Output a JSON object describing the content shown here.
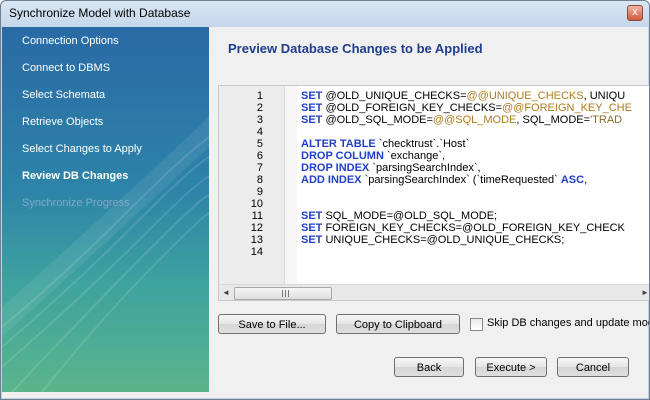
{
  "window": {
    "title": "Synchronize Model with Database",
    "close_glyph": "x"
  },
  "sidebar": {
    "steps": [
      {
        "label": "Connection Options",
        "state": "done"
      },
      {
        "label": "Connect to DBMS",
        "state": "done"
      },
      {
        "label": "Select Schemata",
        "state": "done"
      },
      {
        "label": "Retrieve Objects",
        "state": "done"
      },
      {
        "label": "Select Changes to Apply",
        "state": "done"
      },
      {
        "label": "Review DB Changes",
        "state": "active"
      },
      {
        "label": "Synchronize Progress",
        "state": "disabled"
      }
    ]
  },
  "main": {
    "title": "Preview Database Changes to be Applied",
    "editor": {
      "line_numbers": [
        "1",
        "2",
        "3",
        "4",
        "5",
        "6",
        "7",
        "8",
        "9",
        "10",
        "11",
        "12",
        "13",
        "14"
      ],
      "lines": [
        [
          {
            "t": "kw",
            "v": "SET"
          },
          {
            "t": "p",
            "v": " @OLD_UNIQUE_CHECKS="
          },
          {
            "t": "sv",
            "v": "@@UNIQUE_CHECKS"
          },
          {
            "t": "p",
            "v": ", UNIQU"
          }
        ],
        [
          {
            "t": "kw",
            "v": "SET"
          },
          {
            "t": "p",
            "v": " @OLD_FOREIGN_KEY_CHECKS="
          },
          {
            "t": "sv",
            "v": "@@FOREIGN_KEY_CHE"
          }
        ],
        [
          {
            "t": "kw",
            "v": "SET"
          },
          {
            "t": "p",
            "v": " @OLD_SQL_MODE="
          },
          {
            "t": "sv",
            "v": "@@SQL_MODE"
          },
          {
            "t": "p",
            "v": ", SQL_MODE="
          },
          {
            "t": "str",
            "v": "'TRAD"
          }
        ],
        [],
        [
          {
            "t": "kw",
            "v": "ALTER TABLE"
          },
          {
            "t": "p",
            "v": " `checktrust`.`Host`"
          }
        ],
        [
          {
            "t": "kw",
            "v": "DROP COLUMN"
          },
          {
            "t": "p",
            "v": " `exchange`,"
          }
        ],
        [
          {
            "t": "kw",
            "v": "DROP INDEX"
          },
          {
            "t": "p",
            "v": " `parsingSearchIndex`,"
          }
        ],
        [
          {
            "t": "kw",
            "v": "ADD INDEX"
          },
          {
            "t": "p",
            "v": " `parsingSearchIndex` ("
          },
          {
            "t": "p",
            "v": "`timeRequested` "
          },
          {
            "t": "kw",
            "v": "ASC"
          },
          {
            "t": "p",
            "v": ","
          }
        ],
        [],
        [],
        [
          {
            "t": "kw",
            "v": "SET"
          },
          {
            "t": "p",
            "v": " SQL_MODE=@OLD_SQL_MODE;"
          }
        ],
        [
          {
            "t": "kw",
            "v": "SET"
          },
          {
            "t": "p",
            "v": " FOREIGN_KEY_CHECKS=@OLD_FOREIGN_KEY_CHECK"
          }
        ],
        [
          {
            "t": "kw",
            "v": "SET"
          },
          {
            "t": "p",
            "v": " UNIQUE_CHECKS=@OLD_UNIQUE_CHECKS;"
          }
        ],
        []
      ],
      "scroll_left_glyph": "◄",
      "scroll_right_glyph": "►"
    },
    "buttons": {
      "save_to_file": "Save to File...",
      "copy_to_clipboard": "Copy to Clipboard",
      "back": "Back",
      "execute": "Execute >",
      "cancel": "Cancel"
    },
    "skip_checkbox": {
      "label": "Skip DB changes and update mod",
      "checked": false
    }
  }
}
